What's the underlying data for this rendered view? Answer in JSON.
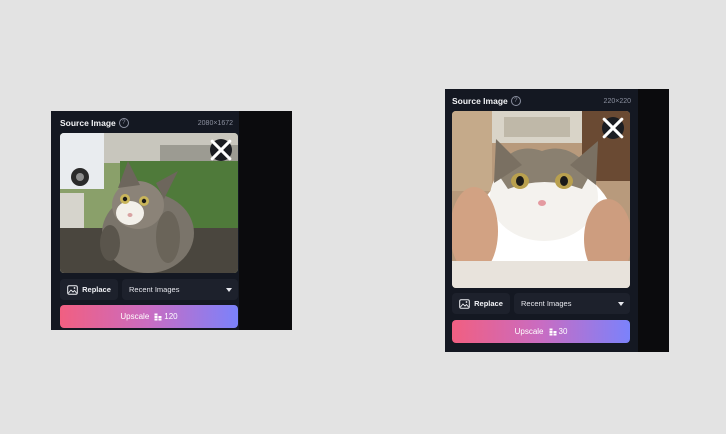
{
  "panels": [
    {
      "title": "Source Image",
      "dimensions": "2080×1672",
      "replace_label": "Replace",
      "recent_label": "Recent Images",
      "upscale_label": "Upscale",
      "credits": "120"
    },
    {
      "title": "Source Image",
      "dimensions": "220×220",
      "replace_label": "Replace",
      "recent_label": "Recent Images",
      "upscale_label": "Upscale",
      "credits": "30"
    }
  ],
  "icons": {
    "help": "question-circle-icon",
    "close": "close-icon",
    "replace": "image-icon",
    "dropdown": "caret-down-icon",
    "credit": "coins-icon"
  },
  "colors": {
    "card_bg": "#141822",
    "button_bg": "#1d212c",
    "gradient_start": "#f15f81",
    "gradient_end": "#7b82fb"
  }
}
